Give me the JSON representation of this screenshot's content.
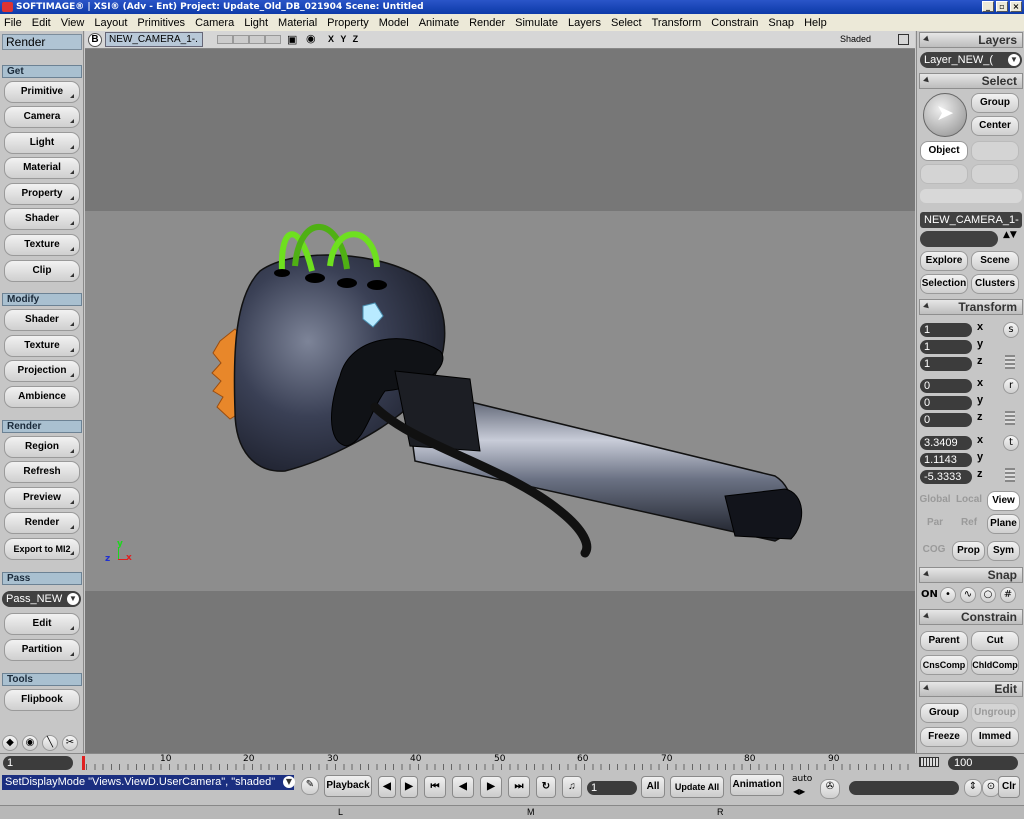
{
  "window": {
    "title": "SOFTIMAGE® | XSI® (Adv - Ent) Project: Update_Old_DB_021904    Scene: Untitled"
  },
  "menu": [
    "File",
    "Edit",
    "View",
    "Layout",
    "Primitives",
    "Camera",
    "Light",
    "Material",
    "Property",
    "Model",
    "Animate",
    "Render",
    "Simulate",
    "Layers",
    "Select",
    "Transform",
    "Constrain",
    "Snap",
    "Help"
  ],
  "left_panel": {
    "title": "Render",
    "get_label": "Get",
    "get_items": [
      "Primitive",
      "Camera",
      "Light",
      "Material",
      "Property",
      "Shader",
      "Texture",
      "Clip"
    ],
    "modify_label": "Modify",
    "modify_items": [
      "Shader",
      "Texture",
      "Projection",
      "Ambience"
    ],
    "render_label": "Render",
    "render_items": [
      "Region",
      "Refresh",
      "Preview",
      "Render",
      "Export to MI2"
    ],
    "pass_label": "Pass",
    "pass_value": "Pass_NEW",
    "pass_items": [
      "Edit",
      "Partition"
    ],
    "tools_label": "Tools",
    "tools_items": [
      "Flipbook"
    ]
  },
  "viewport": {
    "header_letter": "B",
    "camera_name": "NEW_CAMERA_1-.",
    "axes": "X Y Z",
    "mode": "Shaded",
    "gizmo": {
      "x": "x",
      "y": "y",
      "z": "z"
    }
  },
  "right_panel": {
    "layers_title": "Layers",
    "layer_value": "Layer_NEW_(",
    "select_title": "Select",
    "group": "Group",
    "center": "Center",
    "object": "Object",
    "camera_field": "NEW_CAMERA_1-",
    "explore": "Explore",
    "scene": "Scene",
    "selection": "Selection",
    "clusters": "Clusters",
    "transform_title": "Transform",
    "scale": {
      "x": "1",
      "y": "1",
      "z": "1",
      "icon": "s"
    },
    "rotate": {
      "x": "0",
      "y": "0",
      "z": "0",
      "icon": "r"
    },
    "translate": {
      "x": "3.3409",
      "y": "1.1143",
      "z": "-5.3333",
      "icon": "t"
    },
    "global": "Global",
    "local": "Local",
    "view": "View",
    "par": "Par",
    "ref": "Ref",
    "plane": "Plane",
    "cog": "COG",
    "prop": "Prop",
    "sym": "Sym",
    "snap_title": "Snap",
    "on": "ON",
    "constrain_title": "Constrain",
    "parent": "Parent",
    "cut": "Cut",
    "cnscomp": "CnsComp",
    "chldcomp": "ChldComp",
    "edit_title": "Edit",
    "group2": "Group",
    "ungroup": "Ungroup",
    "freeze": "Freeze",
    "immed": "Immed"
  },
  "timeline": {
    "start": "1",
    "end": "100",
    "ticks": [
      "10",
      "20",
      "30",
      "40",
      "50",
      "60",
      "70",
      "80",
      "90"
    ]
  },
  "command": {
    "line": "SetDisplayMode \"Views.ViewD.UserCamera\", \"shaded\"",
    "playback": "Playback",
    "frame": "1",
    "all": "All",
    "update_all": "Update All",
    "animation": "Animation",
    "auto": "auto",
    "clr": "Clr"
  },
  "status": {
    "l": "L",
    "m": "M",
    "r": "R"
  },
  "colors": {
    "accent": "#0d3aa8",
    "section": "#a9c0d0",
    "viewport": "#777777",
    "tube_green": "#6ee01f"
  }
}
